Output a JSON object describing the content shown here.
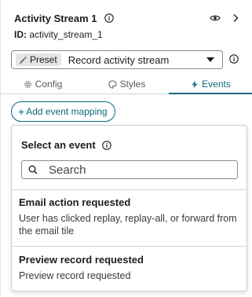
{
  "header": {
    "title": "Activity Stream 1",
    "id_label": "ID:",
    "id_value": "activity_stream_1"
  },
  "preset": {
    "badge": "Preset",
    "value": "Record activity stream"
  },
  "tabs": [
    {
      "label": "Config",
      "icon": "gear-icon",
      "active": false
    },
    {
      "label": "Styles",
      "icon": "palette-icon",
      "active": false
    },
    {
      "label": "Events",
      "icon": "bolt-icon",
      "active": true
    }
  ],
  "add_mapping": {
    "label": "Add event mapping"
  },
  "dropdown": {
    "title": "Select an event",
    "search_placeholder": "Search",
    "options": [
      {
        "title": "Email action requested",
        "description": "User has clicked replay, replay-all, or forward from the email tile"
      },
      {
        "title": "Preview record requested",
        "description": "Preview record requested"
      }
    ]
  },
  "colors": {
    "accent": "#0a6a7a",
    "border": "#d4d4d4",
    "text": "#1d1d1d"
  }
}
